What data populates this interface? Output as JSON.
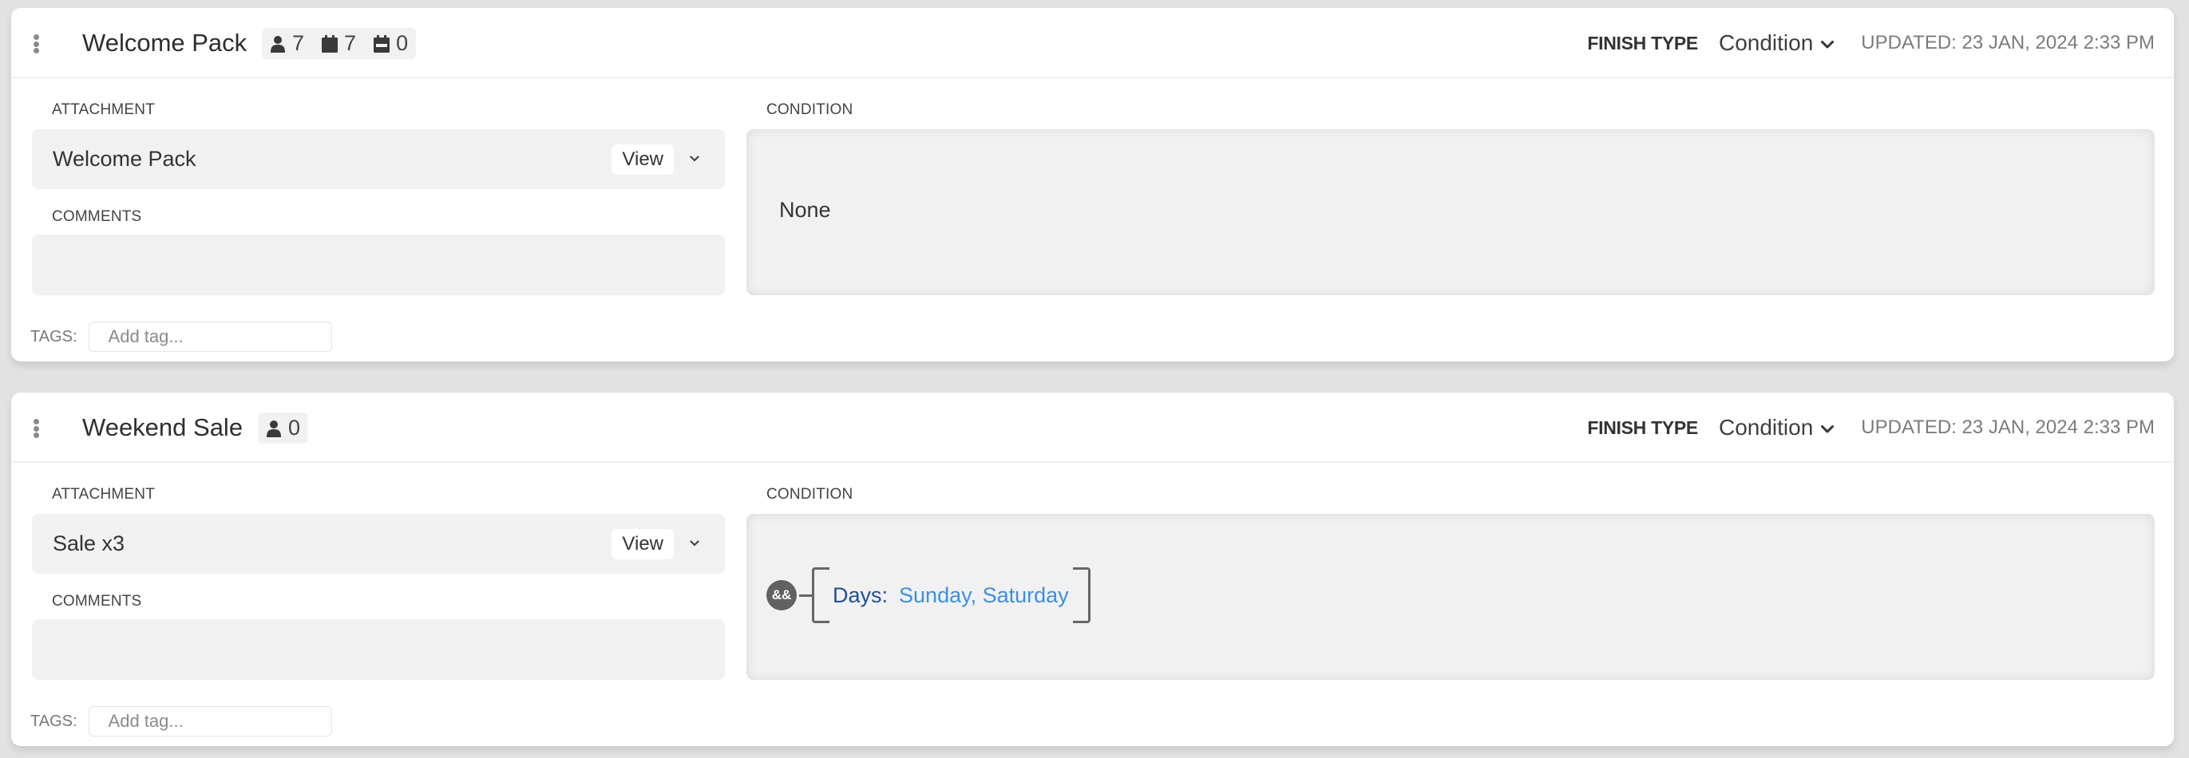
{
  "cards": [
    {
      "title": "Welcome Pack",
      "badges": [
        {
          "icon": "user-icon",
          "count": "7"
        },
        {
          "icon": "calendar-icon",
          "count": "7"
        },
        {
          "icon": "calendar-range-icon",
          "count": "0"
        }
      ],
      "finish_type_label": "FINISH TYPE",
      "finish_type_value": "Condition",
      "updated": "UPDATED: 23 JAN, 2024 2:33 PM",
      "attachment_label": "ATTACHMENT",
      "attachment_name": "Welcome Pack",
      "view_label": "View",
      "comments_label": "COMMENTS",
      "comments_value": "",
      "tags_label": "TAGS:",
      "tags_placeholder": "Add tag...",
      "condition_label": "CONDITION",
      "condition_text": "None"
    },
    {
      "title": "Weekend Sale",
      "badges": [
        {
          "icon": "user-icon",
          "count": "0"
        }
      ],
      "finish_type_label": "FINISH TYPE",
      "finish_type_value": "Condition",
      "updated": "UPDATED: 23 JAN, 2024 2:33 PM",
      "attachment_label": "ATTACHMENT",
      "attachment_name": "Sale x3",
      "view_label": "View",
      "comments_label": "COMMENTS",
      "comments_value": "",
      "tags_label": "TAGS:",
      "tags_placeholder": "Add tag...",
      "condition_label": "CONDITION",
      "condition_operator": "&&",
      "condition_key": "Days:",
      "condition_value": "Sunday, Saturday"
    }
  ],
  "colors": {
    "background": "#e2e2e2",
    "card": "#ffffff",
    "field": "#f1f1f1",
    "condition_key": "#1f4e99",
    "condition_value": "#3d8fe0",
    "operator_badge": "#616161"
  }
}
